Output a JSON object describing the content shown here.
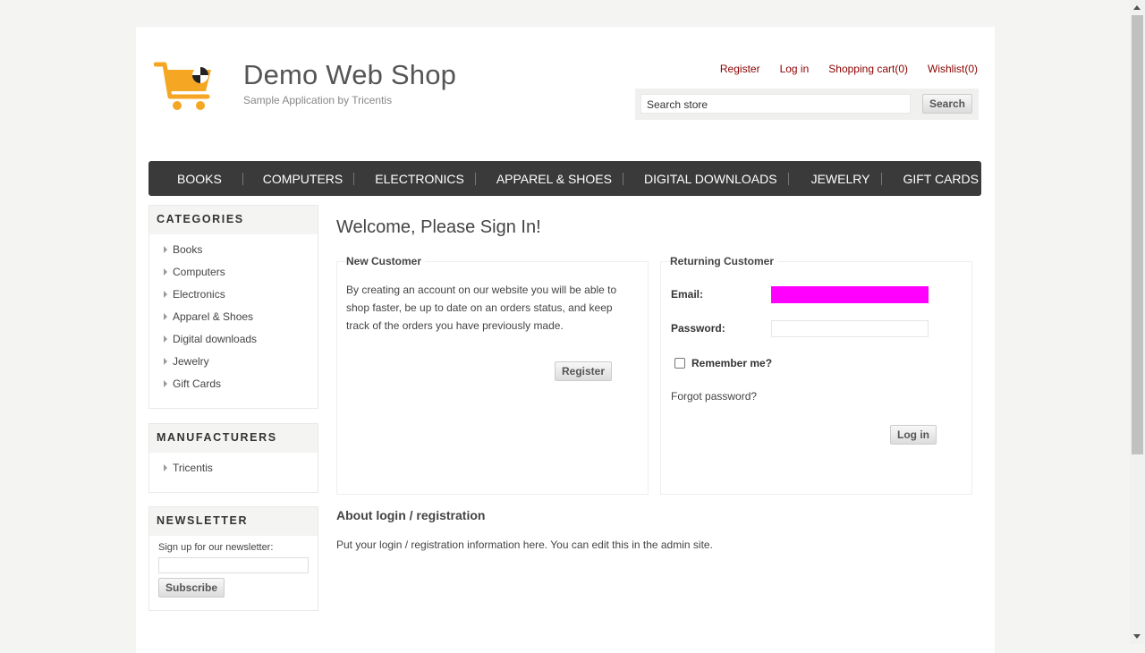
{
  "logo": {
    "title": "Demo Web Shop",
    "subtitle": "Sample Application by Tricentis"
  },
  "header": {
    "links": {
      "register": "Register",
      "login": "Log in",
      "cart": "Shopping cart(0)",
      "wishlist": "Wishlist(0)"
    },
    "search": {
      "value": "Search store",
      "button": "Search"
    }
  },
  "menu": [
    "BOOKS",
    "COMPUTERS",
    "ELECTRONICS",
    "APPAREL & SHOES",
    "DIGITAL DOWNLOADS",
    "JEWELRY",
    "GIFT CARDS"
  ],
  "categories": {
    "title": "CATEGORIES",
    "items": [
      "Books",
      "Computers",
      "Electronics",
      "Apparel & Shoes",
      "Digital downloads",
      "Jewelry",
      "Gift Cards"
    ]
  },
  "manufacturers": {
    "title": "MANUFACTURERS",
    "items": [
      "Tricentis"
    ]
  },
  "newsletter": {
    "title": "NEWSLETTER",
    "label": "Sign up for our newsletter:",
    "button": "Subscribe"
  },
  "main": {
    "title": "Welcome, Please Sign In!",
    "new_customer": {
      "legend": "New Customer",
      "text": "By creating an account on our website you will be able to shop faster, be up to date on an orders status, and keep track of the orders you have previously made.",
      "button": "Register"
    },
    "returning": {
      "legend": "Returning Customer",
      "email_label": "Email:",
      "password_label": "Password:",
      "remember": "Remember me?",
      "forgot": "Forgot password?",
      "button": "Log in"
    },
    "about_title": "About login / registration",
    "about_text": "Put your login / registration information here. You can edit this in the admin site."
  },
  "colors": {
    "link": "#8b0000",
    "menu_bg": "#3a3a3a",
    "cart_orange": "#f5a623",
    "redacted": "#ff00ff"
  },
  "icons": {
    "logo": "shopping-cart-icon",
    "menu_bullet": "triangle-right-icon"
  }
}
